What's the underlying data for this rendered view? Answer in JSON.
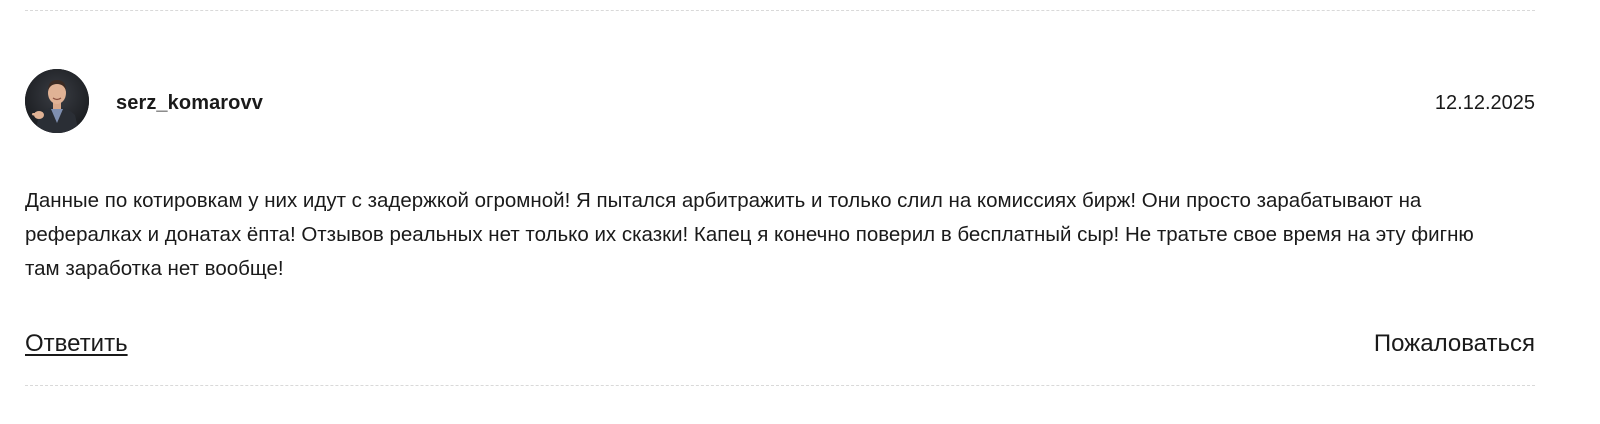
{
  "review": {
    "author": "serz_komarovv",
    "date": "12.12.2025",
    "text": "Данные по котировкам у них идут с задержкой огромной! Я пытался арбитражить и только слил на комиссиях бирж! Они просто зарабатывают на рефералках и донатах ёпта! Отзывов реальных нет только их сказки! Капец я конечно поверил в бесплатный сыр! Не тратьте свое время на эту фигню там заработка нет вообще!",
    "avatar_icon": "user-photo-avatar"
  },
  "actions": {
    "reply_label": "Ответить",
    "report_label": "Пожаловаться"
  },
  "colors": {
    "text": "#1a1a1a",
    "divider": "#d9d9d9",
    "background": "#ffffff"
  }
}
